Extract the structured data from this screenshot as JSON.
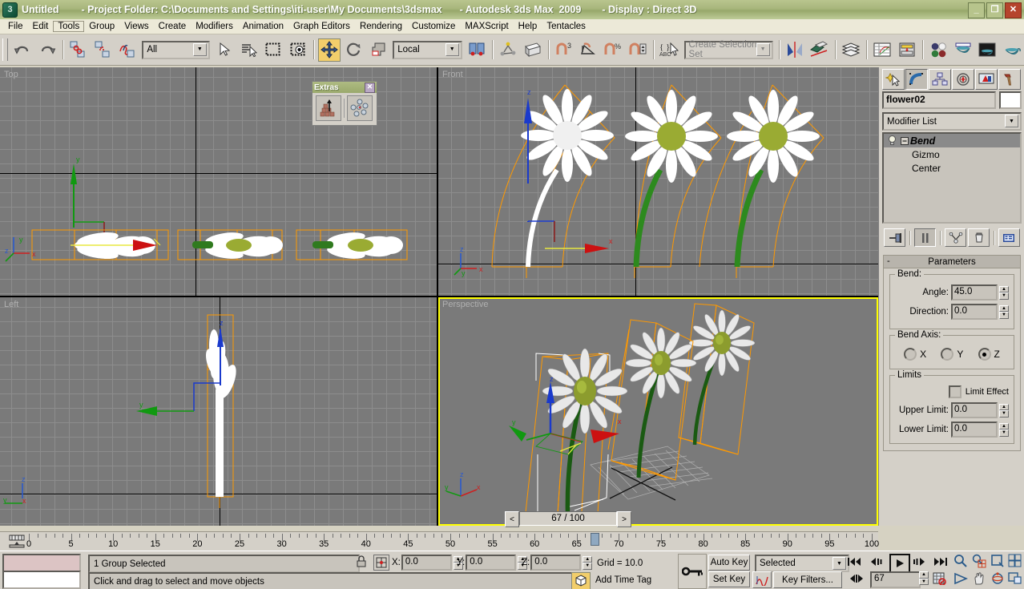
{
  "window": {
    "title_file": "Untitled",
    "title_project": "- Project Folder: C:\\Documents and Settings\\iti-user\\My Documents\\3dsmax",
    "title_app": "- Autodesk 3ds Max  2009",
    "title_display": "- Display : Direct 3D",
    "minimize": "_",
    "restore": "❐",
    "close": "✕"
  },
  "menu": {
    "items": [
      {
        "label": "File",
        "selected": false
      },
      {
        "label": "Edit",
        "selected": false
      },
      {
        "label": "Tools",
        "selected": true
      },
      {
        "label": "Group",
        "selected": false
      },
      {
        "label": "Views",
        "selected": false
      },
      {
        "label": "Create",
        "selected": false
      },
      {
        "label": "Modifiers",
        "selected": false
      },
      {
        "label": "Animation",
        "selected": false
      },
      {
        "label": "Graph Editors",
        "selected": false
      },
      {
        "label": "Rendering",
        "selected": false
      },
      {
        "label": "Customize",
        "selected": false
      },
      {
        "label": "MAXScript",
        "selected": false
      },
      {
        "label": "Help",
        "selected": false
      },
      {
        "label": "Tentacles",
        "selected": false
      }
    ]
  },
  "toolbar": {
    "selection_filter_value": "All",
    "ref_coord_value": "Local",
    "selection_set_placeholder": "Create Selection Set",
    "buttons": [
      "undo-icon",
      "redo-icon",
      "select-and-link-icon",
      "unlink-selection-icon",
      "bind-to-space-warp-icon",
      "select-object-icon",
      "select-by-name-icon",
      "rectangular-selection-region-icon",
      "window-crossing-icon",
      "select-and-move-icon",
      "select-and-rotate-icon",
      "select-and-scale-icon",
      "mirror-icon",
      "align-icon",
      "layer-manager-icon",
      "curve-editor-icon",
      "schematic-view-icon",
      "material-editor-icon",
      "render-setup-icon",
      "rendered-frame-window-icon",
      "render-production-icon"
    ]
  },
  "extras_floater": {
    "title": "Extras",
    "close_label": "✕",
    "buttons": [
      "array-icon",
      "spacing-tool-icon"
    ]
  },
  "viewports": [
    {
      "name": "Top",
      "active": false
    },
    {
      "name": "Front",
      "active": false
    },
    {
      "name": "Left",
      "active": false
    },
    {
      "name": "Perspective",
      "active": true
    }
  ],
  "command_panel": {
    "tabs": [
      {
        "name": "create-tab",
        "active": false
      },
      {
        "name": "modify-tab",
        "active": true
      },
      {
        "name": "hierarchy-tab",
        "active": false
      },
      {
        "name": "motion-tab",
        "active": false
      },
      {
        "name": "display-tab",
        "active": false
      },
      {
        "name": "utilities-tab",
        "active": false
      }
    ],
    "object_name": "flower02",
    "modifier_list_label": "Modifier List",
    "stack": [
      {
        "label": "Bend",
        "selected": true,
        "level": 0
      },
      {
        "label": "Gizmo",
        "selected": false,
        "level": 1
      },
      {
        "label": "Center",
        "selected": false,
        "level": 1
      }
    ],
    "stack_buttons": [
      "pin-stack-icon",
      "show-end-result-icon",
      "make-unique-icon",
      "remove-modifier-icon",
      "configure-modifier-sets-icon"
    ],
    "parameters": {
      "rollout_title": "Parameters",
      "collapse_glyph": "-",
      "bend_group_label": "Bend:",
      "angle_label": "Angle:",
      "angle_value": "45.0",
      "direction_label": "Direction:",
      "direction_value": "0.0",
      "bend_axis_label": "Bend Axis:",
      "axes": [
        {
          "label": "X",
          "selected": false
        },
        {
          "label": "Y",
          "selected": false
        },
        {
          "label": "Z",
          "selected": true
        }
      ],
      "limits_label": "Limits",
      "limit_effect_label": "Limit Effect",
      "limit_effect_checked": false,
      "upper_limit_label": "Upper Limit:",
      "upper_limit_value": "0.0",
      "lower_limit_label": "Lower Limit:",
      "lower_limit_value": "0.0"
    }
  },
  "frame_slider": {
    "prev_label": "<",
    "next_label": ">",
    "readout": "67 / 100"
  },
  "track_bar": {
    "ticks": [
      0,
      5,
      10,
      15,
      20,
      25,
      30,
      35,
      40,
      45,
      50,
      55,
      60,
      65,
      70,
      75,
      80,
      85,
      90,
      95,
      100
    ],
    "current_frame": 67,
    "range_start": 0,
    "range_end": 100
  },
  "status_bar": {
    "selection_status": "1 Group Selected",
    "prompt": "Click and drag to select and move objects",
    "x_label": "X:",
    "x_value": "0.0",
    "y_label": "Y:",
    "y_value": "0.0",
    "z_label": "Z:",
    "z_value": "0.0",
    "grid_label": "Grid = 10.0",
    "add_time_tag": "Add Time Tag",
    "auto_key": "Auto Key",
    "set_key": "Set Key",
    "key_mode_value": "Selected",
    "key_filters": "Key Filters...",
    "current_frame_field": "67"
  },
  "nav_buttons": [
    "zoom-icon",
    "zoom-all-icon",
    "zoom-extents-icon",
    "zoom-extents-all-icon",
    "field-of-view-icon",
    "pan-icon",
    "arc-rotate-icon",
    "maximize-viewport-toggle-icon"
  ],
  "playback_buttons": [
    "goto-start-icon",
    "previous-frame-icon",
    "play-animation-icon",
    "next-frame-icon",
    "goto-end-icon",
    "key-mode-toggle-icon",
    "time-configuration-icon"
  ],
  "colors": {
    "title_bar": "#a8b67c",
    "panel": "#d4d0c8",
    "viewport_bg": "#7a7a7a",
    "active_viewport_border": "#ffff00",
    "selection_orange": "#ff9900",
    "accent_yellow": "#f2ce6b",
    "petal_white": "#ffffff",
    "stem_green": "#2d6b1e",
    "center_olive": "#9aab33"
  }
}
